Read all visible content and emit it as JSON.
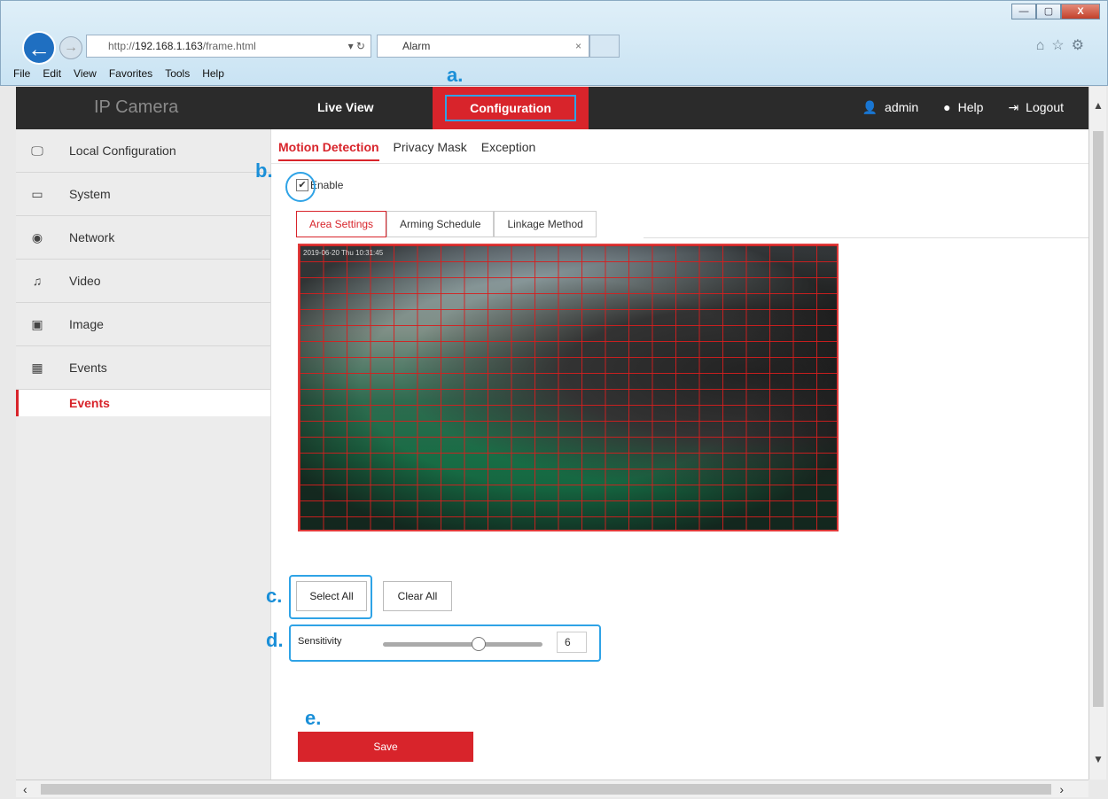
{
  "browser": {
    "url_prefix": "http://",
    "url_host": "192.168.1.163",
    "url_path": "/frame.html",
    "url_controls": "▾ ↻",
    "tab_title": "Alarm",
    "tab_close": "×",
    "menu": [
      "File",
      "Edit",
      "View",
      "Favorites",
      "Tools",
      "Help"
    ],
    "window_buttons": [
      "—",
      "▢",
      "X"
    ],
    "toolbar_icons": "⌂☆⚙"
  },
  "annotations": {
    "a": "a.",
    "b": "b.",
    "c": "c.",
    "d": "d.",
    "e": "e."
  },
  "header": {
    "logo": "IP Camera",
    "live_view": "Live View",
    "configuration": "Configuration",
    "user": "admin",
    "help": "Help",
    "logout": "Logout"
  },
  "sidebar": {
    "items": [
      {
        "label": "Local Configuration",
        "icon": "monitor-icon",
        "glyph": "🖵"
      },
      {
        "label": "System",
        "icon": "window-icon",
        "glyph": "▭"
      },
      {
        "label": "Network",
        "icon": "globe-icon",
        "glyph": "◉"
      },
      {
        "label": "Video",
        "icon": "mic-icon",
        "glyph": "♫"
      },
      {
        "label": "Image",
        "icon": "image-icon",
        "glyph": "▣"
      },
      {
        "label": "Events",
        "icon": "calendar-icon",
        "glyph": "▦"
      }
    ],
    "sub_active": "Events"
  },
  "main": {
    "tabs": [
      "Motion Detection",
      "Privacy Mask",
      "Exception"
    ],
    "enable_label": "Enable",
    "enable_checked": true,
    "steps": [
      "Area Settings",
      "Arming Schedule",
      "Linkage Method"
    ],
    "osd_text": "2019-06-20 Thu 10:31:45",
    "select_all": "Select All",
    "clear_all": "Clear All",
    "sensitivity_label": "Sensitivity",
    "sensitivity_value": "6",
    "sensitivity_fraction": 0.6,
    "save": "Save"
  },
  "colors": {
    "accent": "#d8242b",
    "highlight": "#2fa3e6",
    "header_bg": "#2b2b2b"
  }
}
